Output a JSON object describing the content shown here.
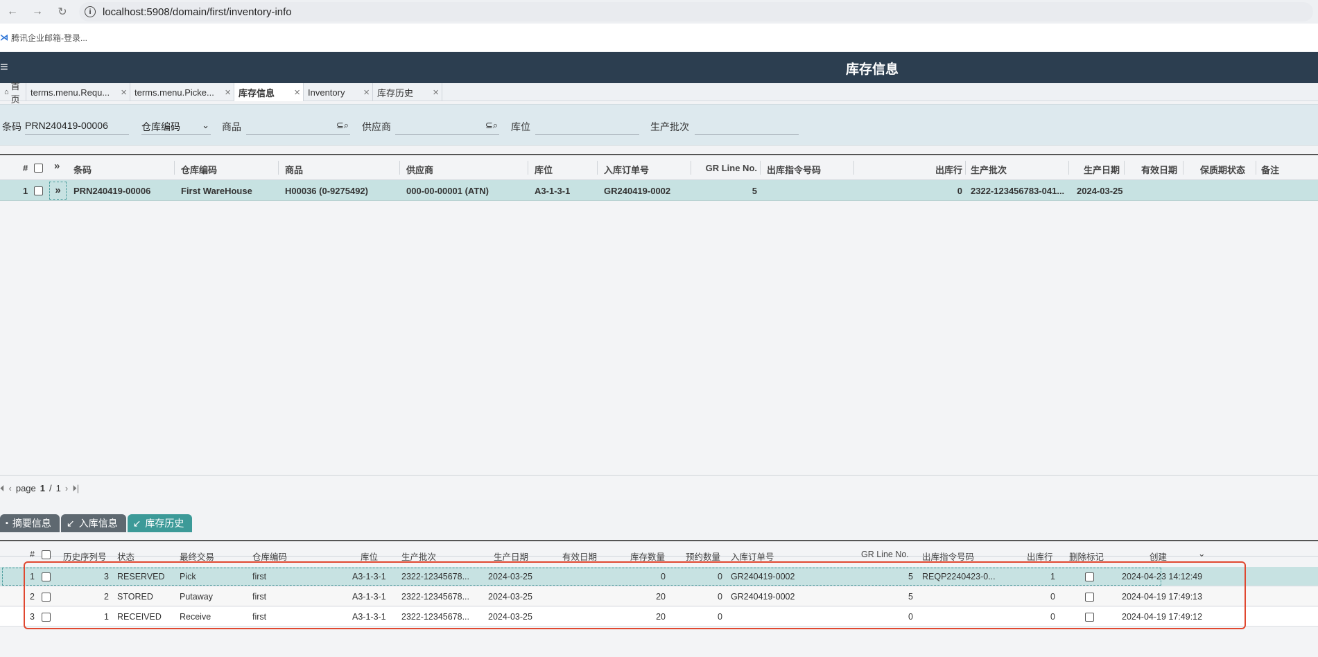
{
  "browser": {
    "url": "localhost:5908/domain/first/inventory-info",
    "bookmark": "腾讯企业邮箱-登录..."
  },
  "app": {
    "title": "库存信息"
  },
  "tabs": [
    {
      "label": "首页"
    },
    {
      "label": "terms.menu.Requ..."
    },
    {
      "label": "terms.menu.Picke..."
    },
    {
      "label": "库存信息"
    },
    {
      "label": "Inventory"
    },
    {
      "label": "库存历史"
    }
  ],
  "filters": {
    "barcode_label": "条码",
    "barcode_value": "PRN240419-00006",
    "warehouse_label": "仓库编码",
    "product_label": "商品",
    "supplier_label": "供应商",
    "location_label": "库位",
    "batch_label": "生产批次"
  },
  "top_grid": {
    "headers": {
      "num": "#",
      "barcode": "条码",
      "warehouse": "仓库编码",
      "product": "商品",
      "supplier": "供应商",
      "location": "库位",
      "gr_order": "入库订单号",
      "gr_line": "GR Line No.",
      "pick_order": "出库指令号码",
      "out_line": "出库行",
      "batch": "生产批次",
      "mfg_date": "生产日期",
      "exp_date": "有效日期",
      "shelf_status": "保质期状态",
      "remark": "备注"
    },
    "row": {
      "num": "1",
      "barcode": "PRN240419-00006",
      "warehouse": "First WareHouse",
      "product": "H00036 (0-9275492)",
      "supplier": "000-00-00001 (ATN)",
      "location": "A3-1-3-1",
      "gr_order": "GR240419-0002",
      "gr_line": "5",
      "out_line": "0",
      "batch": "2322-123456783-041...",
      "mfg_date": "2024-03-25"
    }
  },
  "pager": {
    "page_label": "page",
    "current": "1",
    "sep": "/",
    "total": "1"
  },
  "bottom_tabs": [
    {
      "label": "摘要信息"
    },
    {
      "label": "入库信息"
    },
    {
      "label": "库存历史"
    }
  ],
  "bottom_grid": {
    "headers": {
      "num": "#",
      "seq": "历史序列号",
      "status": "状态",
      "last_tx": "最终交易",
      "warehouse": "仓库编码",
      "location": "库位",
      "batch": "生产批次",
      "mfg_date": "生产日期",
      "exp_date": "有效日期",
      "qty": "库存数量",
      "reserved": "预约数量",
      "gr_order": "入库订单号",
      "gr_line": "GR Line No.",
      "pick_order": "出库指令号码",
      "out_line": "出库行",
      "deleted": "删除标记",
      "created": "创建"
    },
    "rows": [
      {
        "num": "1",
        "seq": "3",
        "status": "RESERVED",
        "last_tx": "Pick",
        "warehouse": "first",
        "location": "A3-1-3-1",
        "batch": "2322-12345678...",
        "mfg_date": "2024-03-25",
        "qty": "0",
        "reserved": "0",
        "gr_order": "GR240419-0002",
        "gr_line": "5",
        "pick_order": "REQP2240423-0...",
        "out_line": "1",
        "created": "2024-04-23 14:12:49"
      },
      {
        "num": "2",
        "seq": "2",
        "status": "STORED",
        "last_tx": "Putaway",
        "warehouse": "first",
        "location": "A3-1-3-1",
        "batch": "2322-12345678...",
        "mfg_date": "2024-03-25",
        "qty": "20",
        "reserved": "0",
        "gr_order": "GR240419-0002",
        "gr_line": "5",
        "pick_order": "",
        "out_line": "0",
        "created": "2024-04-19 17:49:13"
      },
      {
        "num": "3",
        "seq": "1",
        "status": "RECEIVED",
        "last_tx": "Receive",
        "warehouse": "first",
        "location": "A3-1-3-1",
        "batch": "2322-12345678...",
        "mfg_date": "2024-03-25",
        "qty": "20",
        "reserved": "0",
        "gr_order": "",
        "gr_line": "0",
        "pick_order": "",
        "out_line": "0",
        "created": "2024-04-19 17:49:12"
      }
    ]
  },
  "colors": {
    "header_bg": "#2c3e50",
    "selected_row": "#c7e2e2",
    "active_tab": "#3c9a98",
    "highlight": "#e0472f"
  }
}
